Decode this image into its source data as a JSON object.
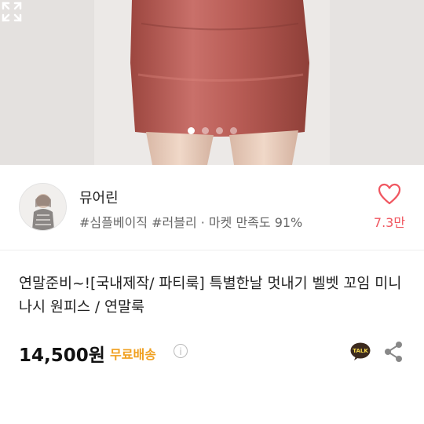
{
  "hero": {
    "image_desc_icon": "product-photo",
    "carousel_dots": 4,
    "active_dot": 0,
    "expand_icon": "expand-icon"
  },
  "seller": {
    "name": "뮤어린",
    "tags": "#심플베이직 #러블리 · 마켓 만족도 91%",
    "like_count": "7.3만"
  },
  "product": {
    "title": "연말준비~![국내제작/ 파티룩] 특별한날 멋내기 벨벳 꼬임 미니 나시 원피스 / 연말룩",
    "price": "14,500원",
    "shipping": "무료배송",
    "talk_label": "TALK"
  },
  "colors": {
    "accent_red": "#f05660",
    "shipping_orange": "#f0a020",
    "dress": "#b35a52"
  }
}
